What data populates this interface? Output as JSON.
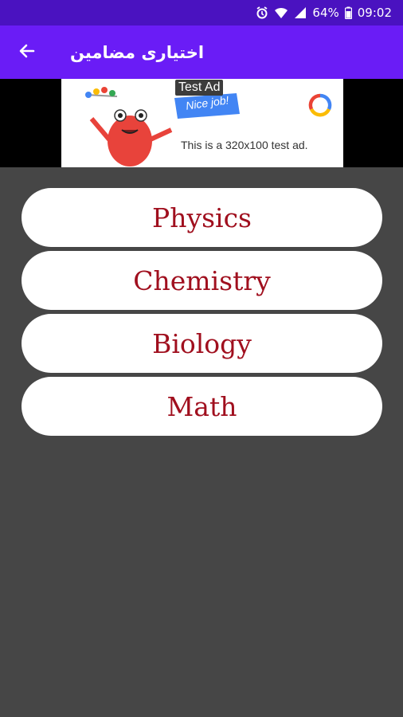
{
  "status_bar": {
    "battery": "64%",
    "time": "09:02",
    "icons": [
      "alarm-icon",
      "wifi-icon",
      "signal-icon",
      "battery-icon"
    ]
  },
  "app_bar": {
    "title": "اختیاری مضامین",
    "back_icon": "arrow-left-icon",
    "color": "#6a1cf6"
  },
  "ad": {
    "label": "Test Ad",
    "flag_text": "Nice job!",
    "text": "This is a 320x100 test ad."
  },
  "subjects": [
    {
      "label": "Physics"
    },
    {
      "label": "Chemistry"
    },
    {
      "label": "Biology"
    },
    {
      "label": "Math"
    }
  ],
  "colors": {
    "status_bar": "#4a12c0",
    "background": "#464646",
    "subject_text": "#a00f1e"
  }
}
